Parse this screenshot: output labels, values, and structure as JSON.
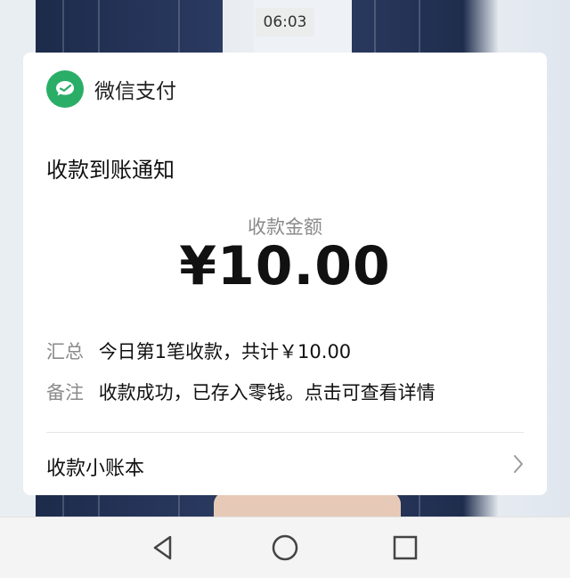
{
  "status": {
    "time": "06:03"
  },
  "notification": {
    "app_name": "微信支付",
    "title": "收款到账通知",
    "amount_label": "收款金额",
    "amount": "¥10.00",
    "summary_key": "汇总",
    "summary_value": "今日第1笔收款，共计￥10.00",
    "note_key": "备注",
    "note_value": "收款成功，已存入零钱。点击可查看详情",
    "ledger_label": "收款小账本",
    "icons": {
      "logo": "wechat-pay-icon",
      "chevron": "chevron-right-icon"
    },
    "colors": {
      "brand": "#2aae67",
      "label_gray": "#8a8a8a"
    }
  },
  "navbar": {
    "buttons": [
      "back-icon",
      "home-icon",
      "recent-apps-icon"
    ]
  }
}
